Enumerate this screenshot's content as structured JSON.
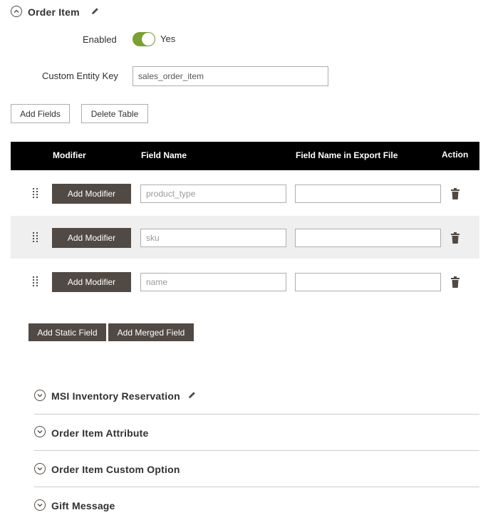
{
  "order_item": {
    "title": "Order Item",
    "enabled_label": "Enabled",
    "enabled_value": "Yes",
    "custom_entity_key_label": "Custom Entity Key",
    "custom_entity_key_value": "sales_order_item",
    "buttons": {
      "add_fields": "Add Fields",
      "delete_table": "Delete Table"
    }
  },
  "table": {
    "headers": {
      "modifier": "Modifier",
      "field_name": "Field Name",
      "export_name": "Field Name in Export File",
      "action": "Action"
    },
    "rows": [
      {
        "modifier_button": "Add Modifier",
        "field_name": "product_type",
        "export_name": ""
      },
      {
        "modifier_button": "Add Modifier",
        "field_name": "sku",
        "export_name": ""
      },
      {
        "modifier_button": "Add Modifier",
        "field_name": "name",
        "export_name": ""
      }
    ]
  },
  "field_buttons": {
    "add_static": "Add Static Field",
    "add_merged": "Add Merged Field"
  },
  "sections": [
    {
      "title": "MSI Inventory Reservation"
    },
    {
      "title": "Order Item Attribute"
    },
    {
      "title": "Order Item Custom Option"
    },
    {
      "title": "Gift Message"
    }
  ],
  "colors": {
    "toggle_on": "#79a22e",
    "dark_button": "#514943",
    "table_header": "#000000",
    "row_shade": "#efefef"
  },
  "icons": {
    "collapse": "chevron-up-circle-icon",
    "expand": "chevron-down-circle-icon",
    "edit": "pencil-icon",
    "drag": "drag-handle-icon",
    "delete": "trash-icon"
  }
}
